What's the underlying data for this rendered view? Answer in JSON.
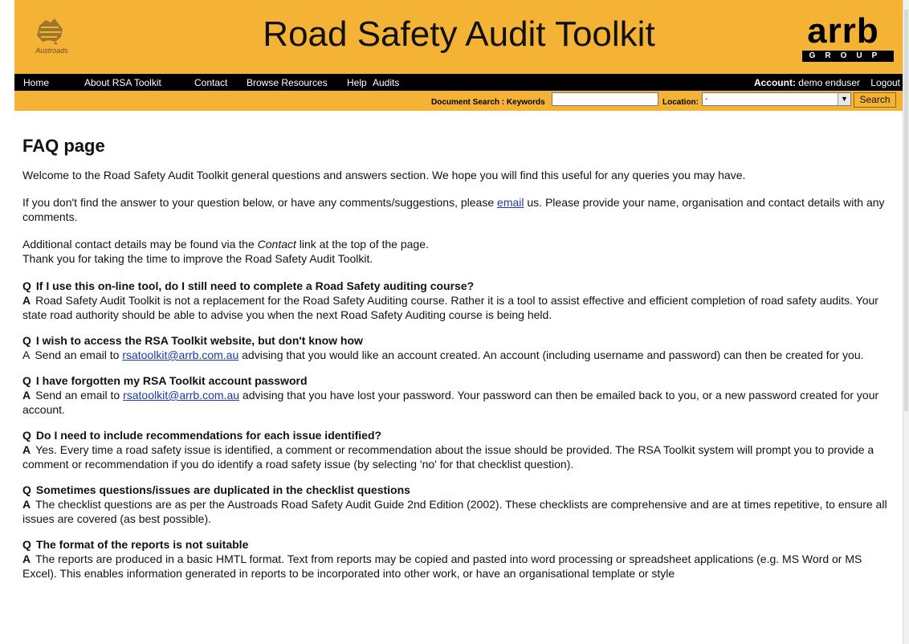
{
  "header": {
    "title": "Road Safety Audit Toolkit",
    "left_logo_text": "Austroads",
    "right_logo_brand": "arrb",
    "right_logo_group": "GROUP"
  },
  "nav": {
    "items": [
      "Home",
      "About RSA Toolkit",
      "Contact",
      "Browse Resources",
      "Help",
      "Audits"
    ],
    "account_label": "Account:",
    "account_user": "demo enduser",
    "logout": "Logout"
  },
  "search": {
    "keywords_label": "Document Search : Keywords",
    "keywords_value": "",
    "location_label": "Location:",
    "location_value": "-",
    "button": "Search"
  },
  "page": {
    "heading": "FAQ page",
    "intro": "Welcome to the Road Safety Audit Toolkit general questions and answers section. We hope you will find this useful for any queries you may have.",
    "p2_before": "If you don't find the answer to your question below, or have any comments/suggestions, please ",
    "p2_link": "email",
    "p2_after": " us. Please provide your name, organisation and contact details with any comments.",
    "p3_before": "Additional contact details may be found via the ",
    "p3_em": "Contact",
    "p3_after": " link at the top of the page.",
    "p3_line2": "Thank you for taking the time to improve the Road Safety Audit Toolkit."
  },
  "faq": [
    {
      "q": "If I use this on-line tool, do I still need to complete a Road Safety auditing course?",
      "a_before": "Road Safety Audit Toolkit is not a replacement for the Road Safety Auditing course. Rather it is a tool to assist effective and efficient completion of road safety audits. Your state road authority should be able to advise you when the next Road Safety Auditing course is being held.",
      "a_link": "",
      "a_after": ""
    },
    {
      "q": "I wish to access the RSA Toolkit website, but don't know how",
      "a_before": "Send an email to ",
      "a_link": "rsatoolkit@arrb.com.au",
      "a_after": " advising that you would like an account created. An account (including username and password) can then be created for you."
    },
    {
      "q": "I have forgotten my RSA Toolkit account password",
      "a_before": "Send an email to ",
      "a_link": "rsatoolkit@arrb.com.au",
      "a_after": " advising that you have lost your password. Your password can then be emailed back to you, or a new password created for your account."
    },
    {
      "q": "Do I need to include recommendations for each issue identified?",
      "a_before": "Yes. Every time a road safety issue is identified, a comment or recommendation about the issue should be provided. The RSA Toolkit system will prompt you to provide a comment or recommendation if you do identify a road safety issue (by selecting 'no' for that checklist question).",
      "a_link": "",
      "a_after": ""
    },
    {
      "q": "Sometimes questions/issues are duplicated in the checklist questions",
      "a_before": "The checklist questions are as per the Austroads Road Safety Audit Guide 2nd Edition (2002). These checklists are comprehensive and are at times repetitive, to ensure all issues are covered (as best possible).",
      "a_link": "",
      "a_after": ""
    },
    {
      "q": "The format of the reports is not suitable",
      "a_before": "The reports are produced in a basic HMTL format. Text from reports may be copied and pasted into word processing or spreadsheet applications (e.g. MS Word or MS Excel). This enables information generated in reports to be incorporated into other work, or have an organisational template or style",
      "a_link": "",
      "a_after": ""
    }
  ],
  "labels": {
    "q": "Q",
    "a": "A"
  }
}
